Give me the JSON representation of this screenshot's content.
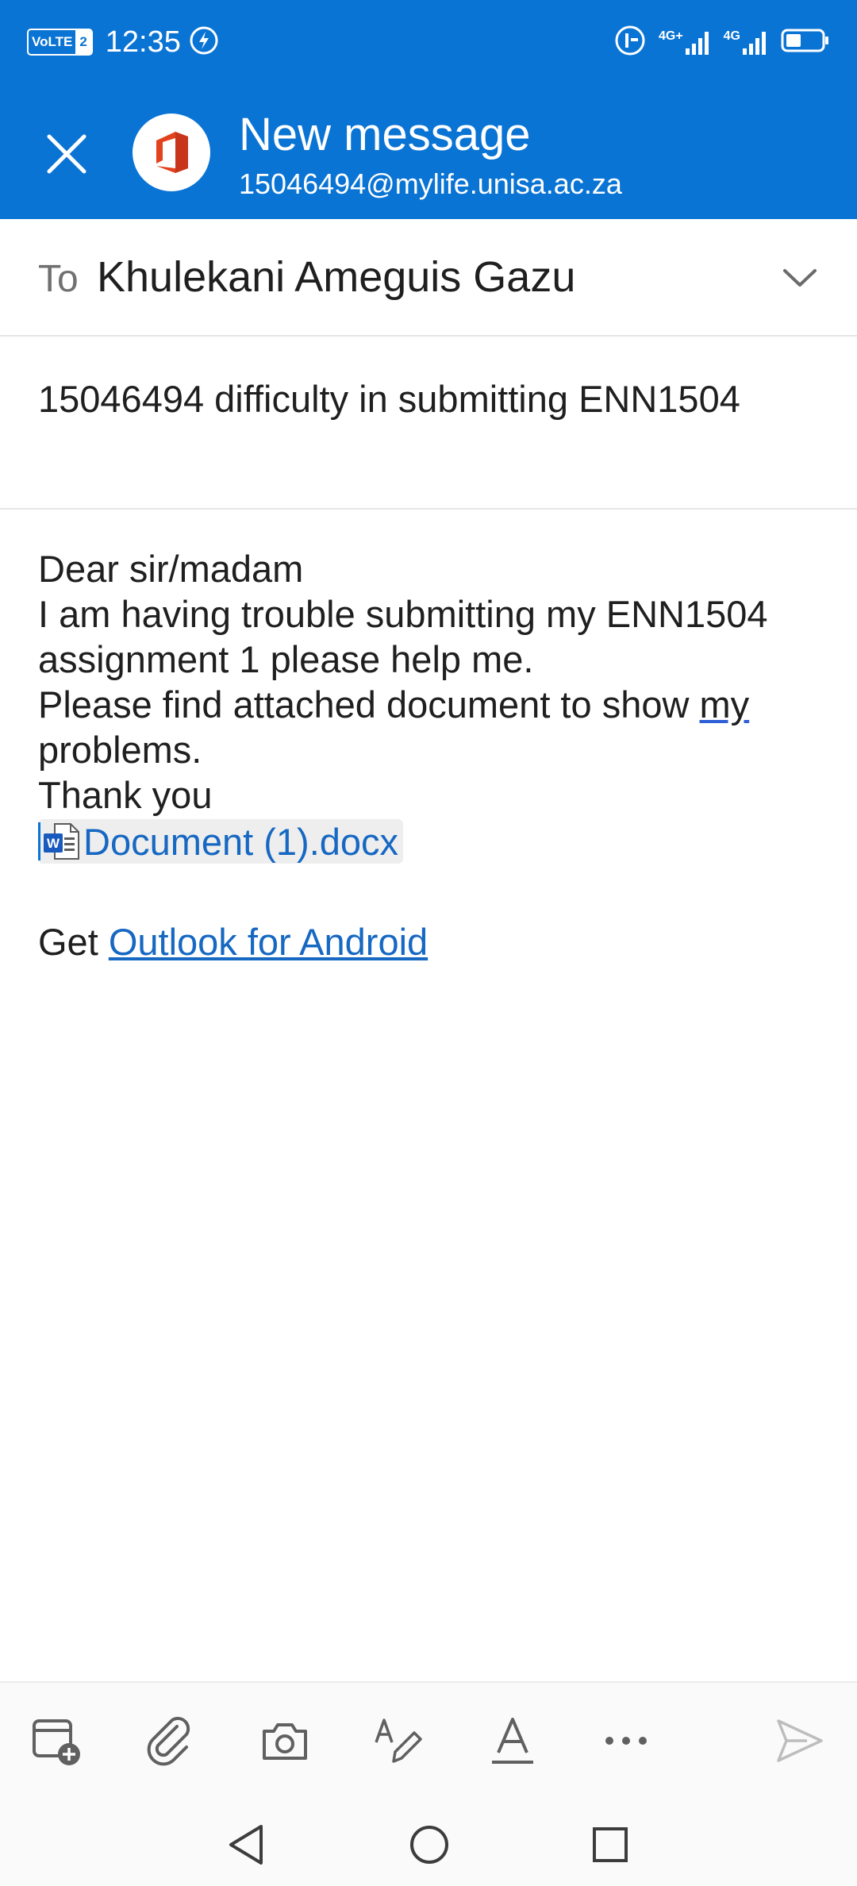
{
  "status_bar": {
    "volte_label": "VoLTE",
    "sim_number": "2",
    "time": "12:35",
    "network_1": "4G+",
    "network_2": "4G"
  },
  "header": {
    "title": "New message",
    "account": "15046494@mylife.unisa.ac.za",
    "close_icon": "close-icon",
    "app_icon": "office-logo-icon",
    "color": "#0a74d4"
  },
  "compose": {
    "to_label": "To",
    "to_value": "Khulekani Ameguis Gazu",
    "subject": "15046494 difficulty in submitting ENN1504",
    "body": {
      "line1": "Dear sir/madam",
      "line2": "I am having trouble submitting my ENN1504",
      "line3": "assignment 1 please help me.",
      "line4_prefix": "Please find attached document to show ",
      "line4_underlined": "my",
      "line5": "problems.",
      "line6": "Thank you",
      "attachment_name": "Document (1).docx",
      "signature_prefix": "Get ",
      "signature_link": "Outlook for Android"
    }
  },
  "toolbar": {
    "icons": [
      "new-event-icon",
      "attach-icon",
      "camera-icon",
      "draw-icon",
      "format-text-icon",
      "more-icon",
      "send-icon"
    ]
  },
  "navigation": {
    "icons": [
      "back-icon",
      "home-icon",
      "recents-icon"
    ]
  }
}
